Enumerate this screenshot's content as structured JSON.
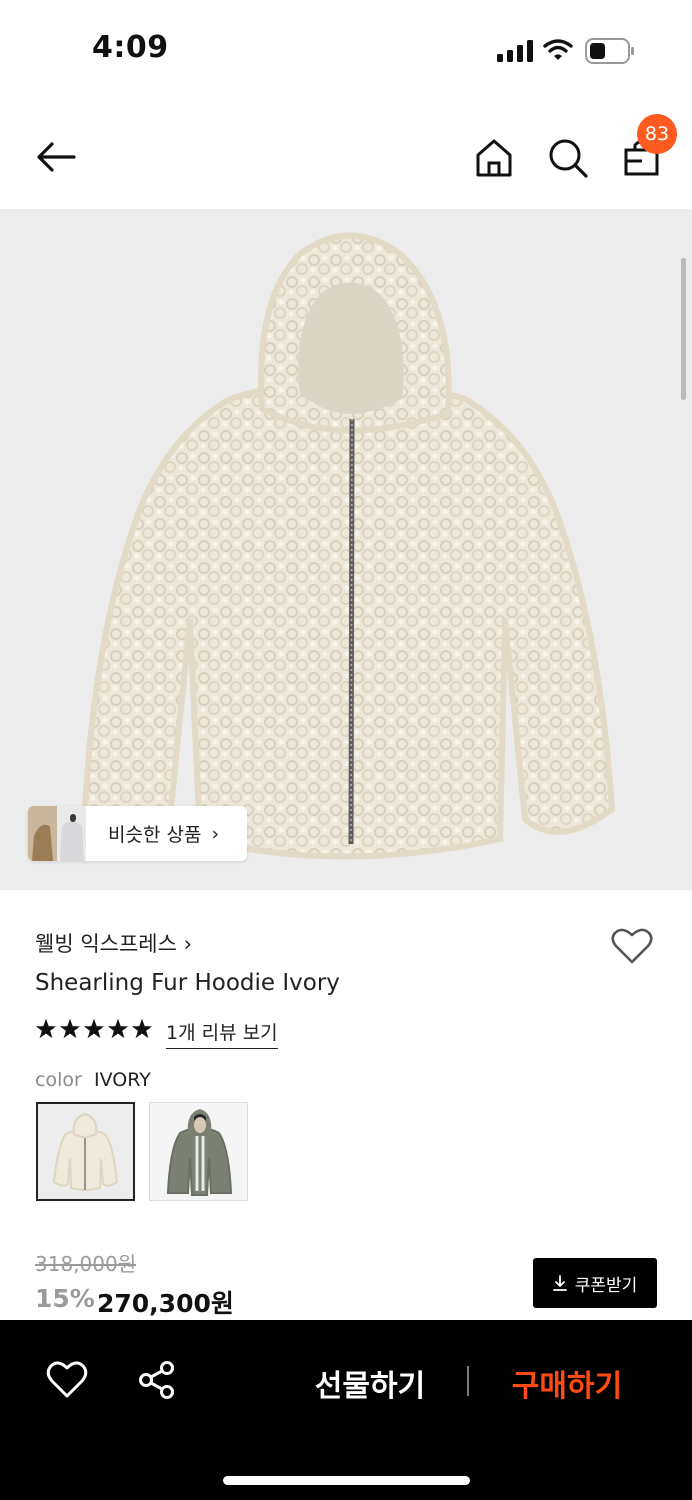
{
  "status_bar": {
    "time": "4:09"
  },
  "header": {
    "cart_count": "83"
  },
  "hero": {
    "similar_label": "비슷한 상품"
  },
  "product": {
    "brand": "웰빙 익스프레스",
    "title": "Shearling Fur Hoodie Ivory",
    "rating_stars": 5,
    "review_link": "1개 리뷰 보기",
    "color_key": "color",
    "color_value": "IVORY"
  },
  "price": {
    "original": "318,000원",
    "discount": "15%",
    "sale": "270,300원",
    "coupon_label": "쿠폰받기"
  },
  "bottom_bar": {
    "gift_label": "선물하기",
    "buy_label": "구매하기"
  },
  "colors": {
    "accent": "#ff4a12",
    "badge": "#ff5a1f"
  }
}
